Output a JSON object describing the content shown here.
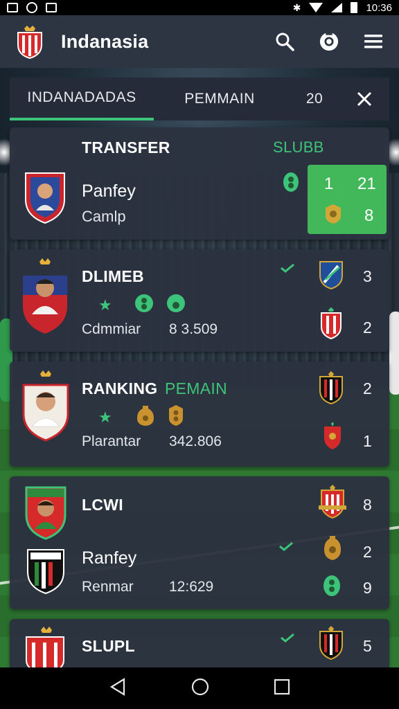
{
  "status_bar": {
    "time": "10:36"
  },
  "app": {
    "title": "Indanasia"
  },
  "tabs": [
    {
      "label": "INDANADADAS"
    },
    {
      "label": "PEMMAIN"
    },
    {
      "label": "20"
    }
  ],
  "cards": [
    {
      "title": "TRANSFER",
      "tag": "SLUBB",
      "name": "Panfey",
      "subtitle": "Camlp",
      "score": {
        "top_left": "1",
        "top_right": "21",
        "bottom_right": "8"
      }
    },
    {
      "title": "DLIMEB",
      "label": "Cdmmiar",
      "value": "8 3.509",
      "numbers": [
        "3",
        "2"
      ]
    },
    {
      "title": "RANKING",
      "tag": "PEMAIN",
      "label": "Plarantar",
      "value": "342.806",
      "numbers": [
        "2",
        "1"
      ]
    },
    {
      "title": "LCWI",
      "name": "Ranfey",
      "label": "Renmar",
      "value": "12:629",
      "numbers": [
        "8",
        "2",
        "9"
      ]
    },
    {
      "title": "SLUPL",
      "numbers": [
        "5"
      ]
    }
  ],
  "colors": {
    "accent_green": "#3ec47a",
    "card_bg": "#2c3240",
    "appbar_bg": "#2d3442"
  }
}
